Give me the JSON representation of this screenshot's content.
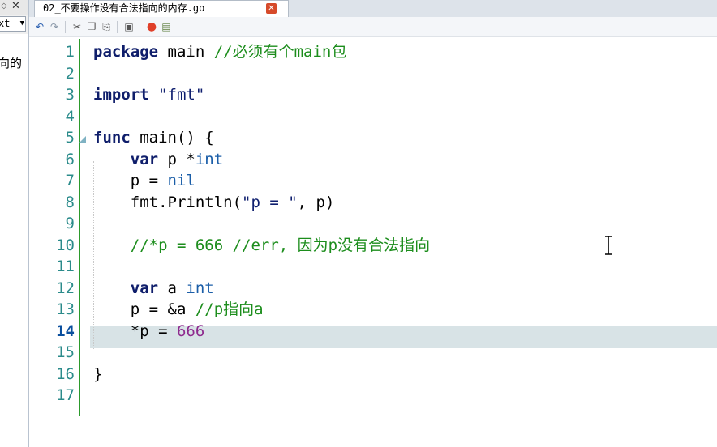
{
  "side_panel": {
    "select_value": "xt",
    "tree_text": "向的"
  },
  "tab": {
    "title": "02_不要操作没有合法指向的内存.go"
  },
  "toolbar": {
    "icons": [
      "undo-icon",
      "redo-icon",
      "cut-icon",
      "copy-icon",
      "paste-icon",
      "find-icon",
      "run-icon",
      "build-icon"
    ]
  },
  "editor": {
    "current_line": 14,
    "line_numbers": [
      "1",
      "2",
      "3",
      "4",
      "5",
      "6",
      "7",
      "8",
      "9",
      "10",
      "11",
      "12",
      "13",
      "14",
      "15",
      "16",
      "17"
    ],
    "lines": [
      [
        {
          "t": "package",
          "c": "kw"
        },
        {
          "t": " main ",
          "c": ""
        },
        {
          "t": "//必须有个main包",
          "c": "cmt"
        }
      ],
      [],
      [
        {
          "t": "import",
          "c": "kw"
        },
        {
          "t": " ",
          "c": ""
        },
        {
          "t": "\"fmt\"",
          "c": "str"
        }
      ],
      [],
      [
        {
          "t": "func",
          "c": "kw"
        },
        {
          "t": " main() {",
          "c": ""
        }
      ],
      [
        {
          "t": "    ",
          "c": ""
        },
        {
          "t": "var",
          "c": "kw"
        },
        {
          "t": " p *",
          "c": ""
        },
        {
          "t": "int",
          "c": "type"
        }
      ],
      [
        {
          "t": "    p = ",
          "c": ""
        },
        {
          "t": "nil",
          "c": "nil"
        }
      ],
      [
        {
          "t": "    fmt.Println(",
          "c": ""
        },
        {
          "t": "\"p = \"",
          "c": "str"
        },
        {
          "t": ", p)",
          "c": ""
        }
      ],
      [],
      [
        {
          "t": "    ",
          "c": ""
        },
        {
          "t": "//*p = 666 //err, 因为p没有合法指向",
          "c": "cmt"
        }
      ],
      [],
      [
        {
          "t": "    ",
          "c": ""
        },
        {
          "t": "var",
          "c": "kw"
        },
        {
          "t": " a ",
          "c": ""
        },
        {
          "t": "int",
          "c": "type"
        }
      ],
      [
        {
          "t": "    p = &a ",
          "c": ""
        },
        {
          "t": "//p指向a",
          "c": "cmt"
        }
      ],
      [
        {
          "t": "    *p = ",
          "c": ""
        },
        {
          "t": "666",
          "c": "num"
        }
      ],
      [],
      [
        {
          "t": "}",
          "c": ""
        }
      ],
      []
    ]
  }
}
